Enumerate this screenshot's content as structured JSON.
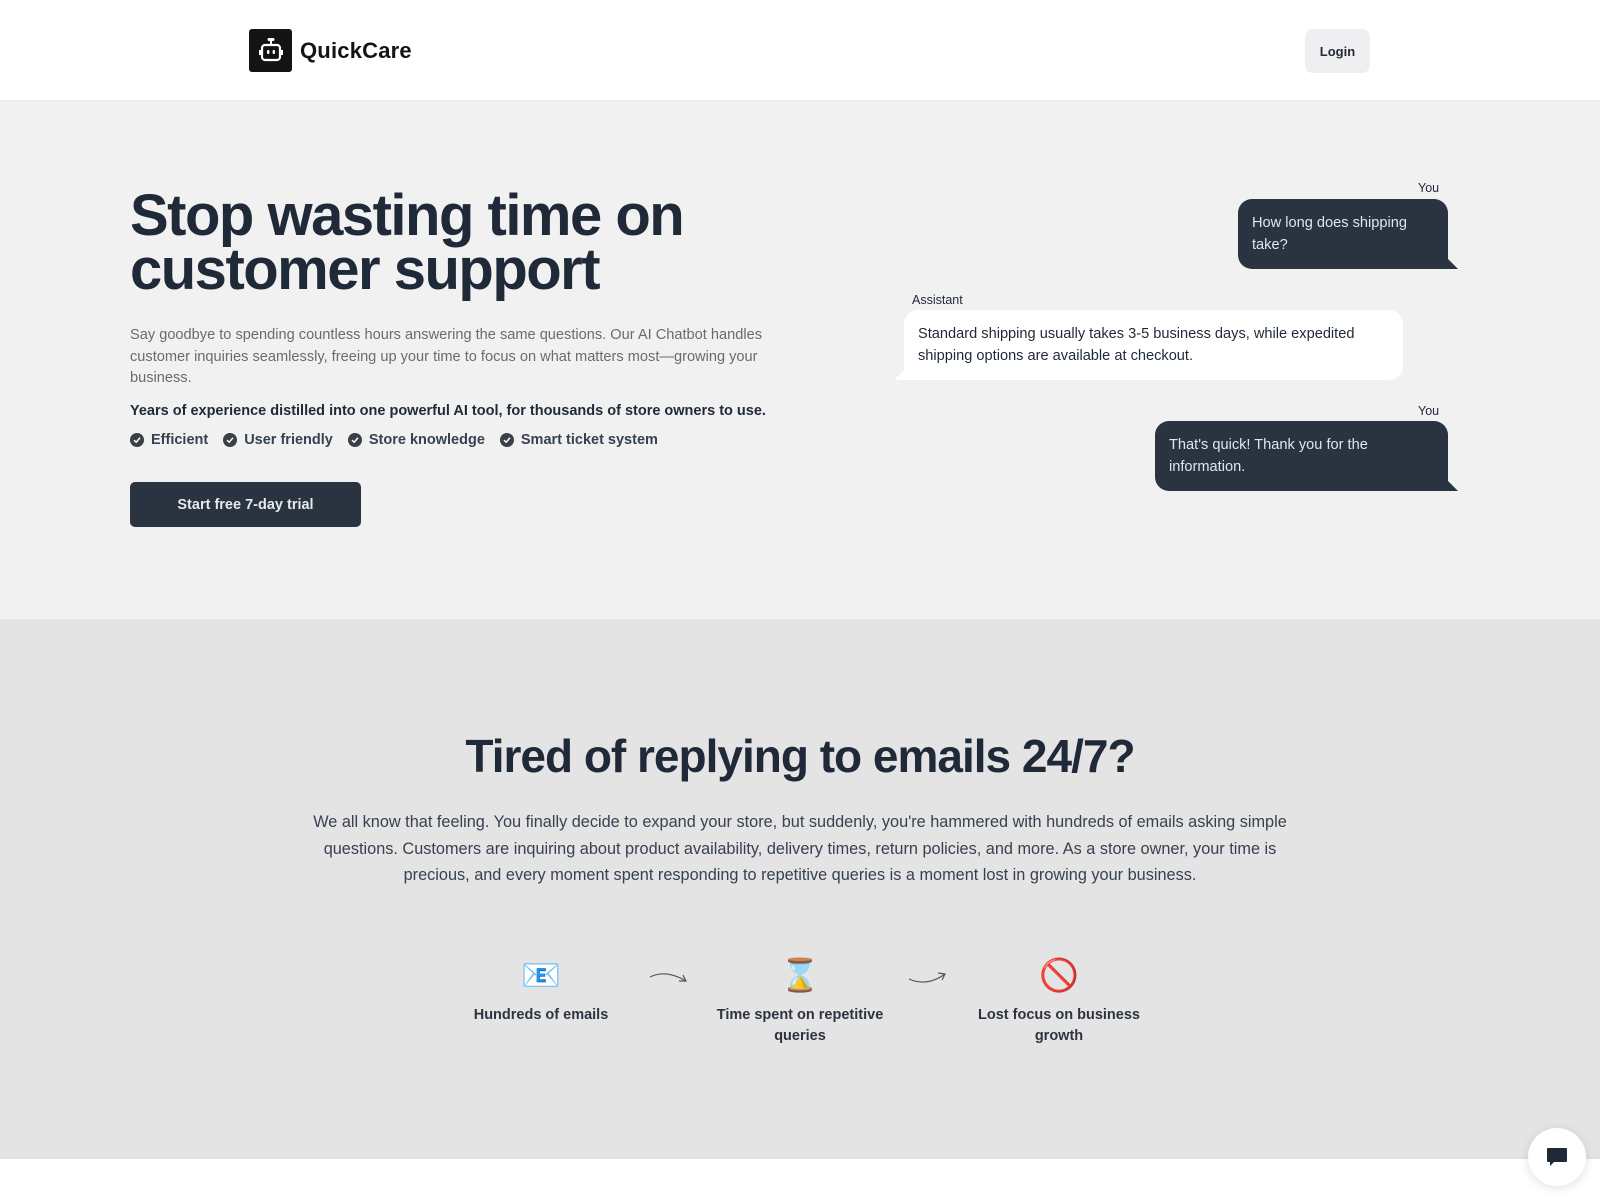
{
  "header": {
    "brand": "QuickCare",
    "logo_icon": "robot-icon",
    "login_label": "Login"
  },
  "hero": {
    "title": "Stop wasting time on customer support",
    "description": "Say goodbye to spending countless hours answering the same questions. Our AI Chatbot handles customer inquiries seamlessly, freeing up your time to focus on what matters most—growing your business.",
    "tagline": "Years of experience distilled into one powerful AI tool, for thousands of store owners to use.",
    "features": [
      {
        "label": "Efficient",
        "icon": "check-circle-icon"
      },
      {
        "label": "User friendly",
        "icon": "check-circle-icon"
      },
      {
        "label": "Store knowledge",
        "icon": "check-circle-icon"
      },
      {
        "label": "Smart ticket system",
        "icon": "check-circle-icon"
      }
    ],
    "cta_label": "Start free 7-day trial"
  },
  "chat": {
    "messages": [
      {
        "sender": "You",
        "role": "user",
        "text": "How long does shipping take?"
      },
      {
        "sender": "Assistant",
        "role": "assistant",
        "text": "Standard shipping usually takes 3-5 business days, while expedited shipping options are available at checkout."
      },
      {
        "sender": "You",
        "role": "user",
        "text": "That's quick! Thank you for the information."
      }
    ]
  },
  "problem": {
    "title": "Tired of replying to emails 24/7?",
    "description": "We all know that feeling. You finally decide to expand your store, but suddenly, you're hammered with hundreds of emails asking simple questions. Customers are inquiring about product availability, delivery times, return policies, and more. As a store owner, your time is precious, and every moment spent responding to repetitive queries is a moment lost in growing your business.",
    "steps": [
      {
        "icon": "📧",
        "icon_name": "email-icon",
        "label": "Hundreds of emails"
      },
      {
        "icon": "⌛",
        "icon_name": "hourglass-icon",
        "label": "Time spent on repetitive queries"
      },
      {
        "icon": "🚫",
        "icon_name": "prohibited-icon",
        "label": "Lost focus on business growth"
      }
    ]
  },
  "widget": {
    "icon": "chat-bubble-icon"
  },
  "colors": {
    "primary_dark": "#2a3441",
    "hero_bg": "#f1f1f1",
    "section_bg": "#e4e4e4",
    "text_dark": "#1f2937"
  }
}
